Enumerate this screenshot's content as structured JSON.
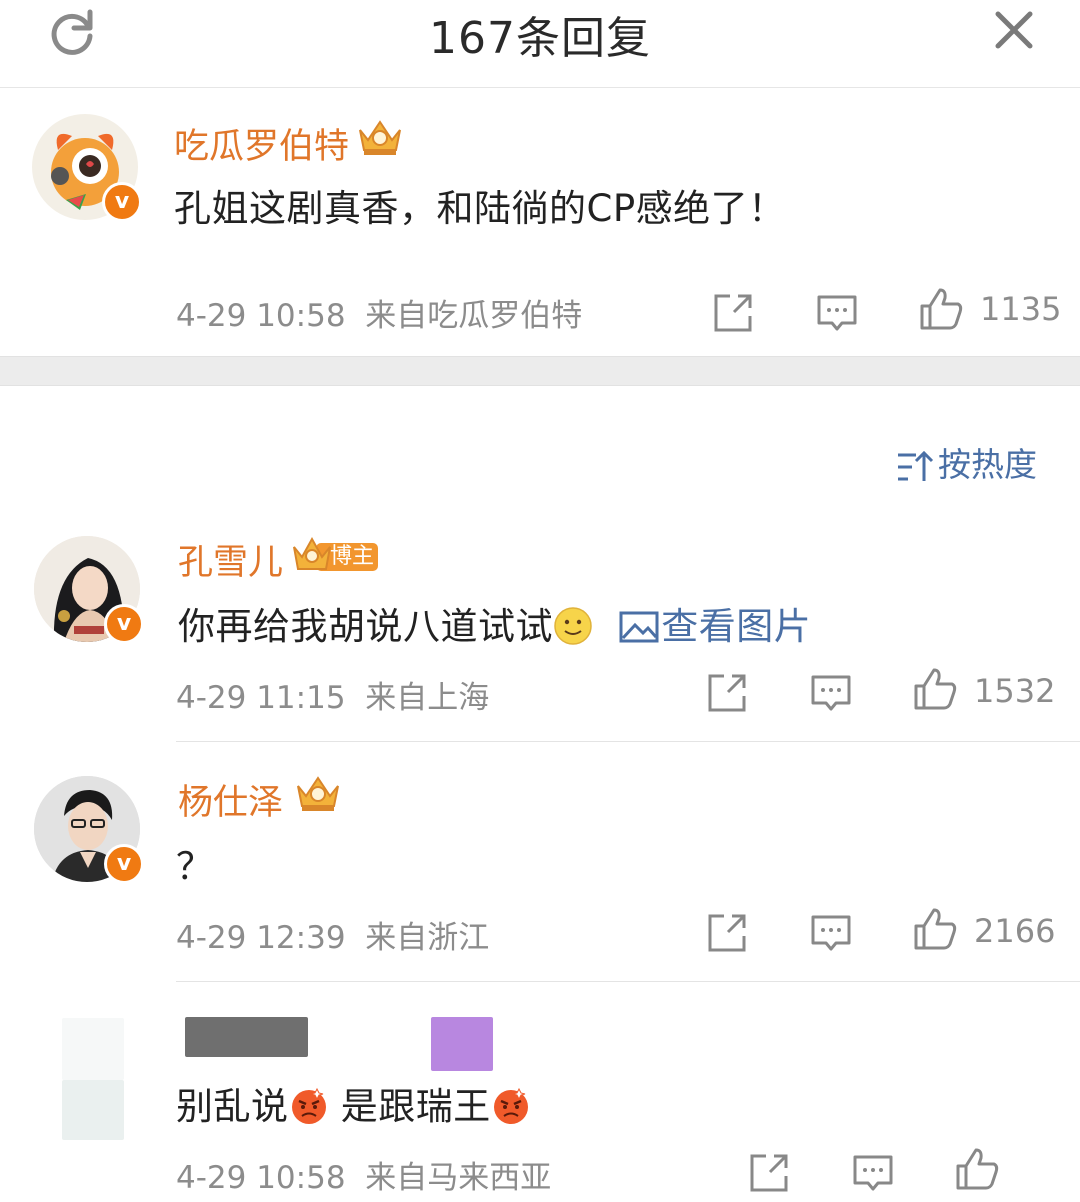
{
  "header": {
    "title": "167条回复",
    "refresh_icon": "refresh-icon",
    "close_icon": "close-icon"
  },
  "root_comment": {
    "username": "吃瓜罗伯特",
    "content": "孔姐这剧真香，和陆徜的CP感绝了！",
    "time": "4-29 10:58",
    "source": "来自吃瓜罗伯特",
    "like_count": "1135"
  },
  "sort": {
    "label": "按热度"
  },
  "replies": [
    {
      "username": "孔雪儿",
      "tag": "博主",
      "content": "你再给我胡说八道试试",
      "view_image": "查看图片",
      "time": "4-29 11:15",
      "source": "来自上海",
      "like_count": "1532"
    },
    {
      "username": "杨仕泽",
      "content": "？",
      "time": "4-29 12:39",
      "source": "来自浙江",
      "like_count": "2166"
    },
    {
      "content_a": "别乱说",
      "content_b": "是跟瑞王",
      "time": "4-29 10:58",
      "source": "来自马来西亚"
    }
  ],
  "colors": {
    "username": "#e0762a",
    "link": "#4a6fa5",
    "meta": "#8c8c8c",
    "vip_badge": "#f07a12"
  }
}
